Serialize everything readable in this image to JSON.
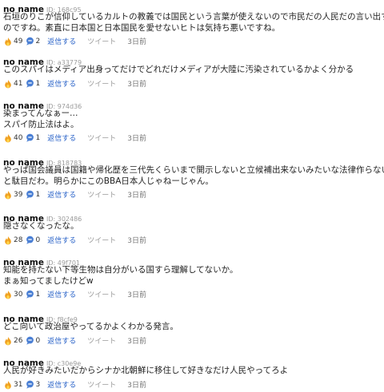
{
  "actions": {
    "reply": "返信する",
    "tweet": "ツイート"
  },
  "comments": [
    {
      "name": "no name",
      "id": "ID: 168c95",
      "lines": [
        "石垣のりこが信仰しているカルトの教義では国民という言葉が使えないので市民だの人民だの言い出す",
        "のですね。素直に日本国と日本国民を愛せないヒトは気持ち悪いですね。"
      ],
      "likes": "49",
      "replies": "2",
      "time": "3日前"
    },
    {
      "name": "no name",
      "id": "ID: a33779",
      "lines": [
        "このスパイはメディア出身ってだけでどれだけメディアが大陸に汚染されているかよく分かる"
      ],
      "likes": "41",
      "replies": "1",
      "time": "3日前"
    },
    {
      "name": "no name",
      "id": "ID: 974d36",
      "lines": [
        "染まってんなぁー…",
        "スパイ防止法はよ。"
      ],
      "likes": "40",
      "replies": "1",
      "time": "3日前"
    },
    {
      "name": "no name",
      "id": "ID: 818783",
      "lines": [
        "やっぱ国会議員は国籍や帰化歴を三代先くらいまで開示しないと立候補出来ないみたいな法律作らない",
        "と駄目だわ。明らかにこのBBA日本人じゃねーじゃん。"
      ],
      "likes": "39",
      "replies": "1",
      "time": "3日前"
    },
    {
      "name": "no name",
      "id": "ID: 302486",
      "lines": [
        "隠さなくなったな。"
      ],
      "likes": "28",
      "replies": "0",
      "time": "3日前"
    },
    {
      "name": "no name",
      "id": "ID: 49f701",
      "lines": [
        "知能を持たない下等生物は自分がいる国すら理解してないか。",
        "まぁ知ってましたけどw"
      ],
      "likes": "30",
      "replies": "1",
      "time": "3日前"
    },
    {
      "name": "no name",
      "id": "ID: f8cfe9",
      "lines": [
        "どこ向いて政治屋やってるかよくわかる発言。"
      ],
      "likes": "26",
      "replies": "0",
      "time": "3日前"
    },
    {
      "name": "no name",
      "id": "ID: c30e9e",
      "lines": [
        "人民が好きみたいだからシナか北朝鮮に移住して好きなだけ人民やってろよ"
      ],
      "likes": "31",
      "replies": "3",
      "time": "3日前"
    }
  ],
  "icons": {
    "likes": "fire-icon",
    "replies": "reply-bubble-icon"
  },
  "colors": {
    "fire": "#f0a020",
    "reply_icon": "#4a7fd4",
    "reply_link": "#2a63c8",
    "tweet_link": "#9b9b9b"
  }
}
